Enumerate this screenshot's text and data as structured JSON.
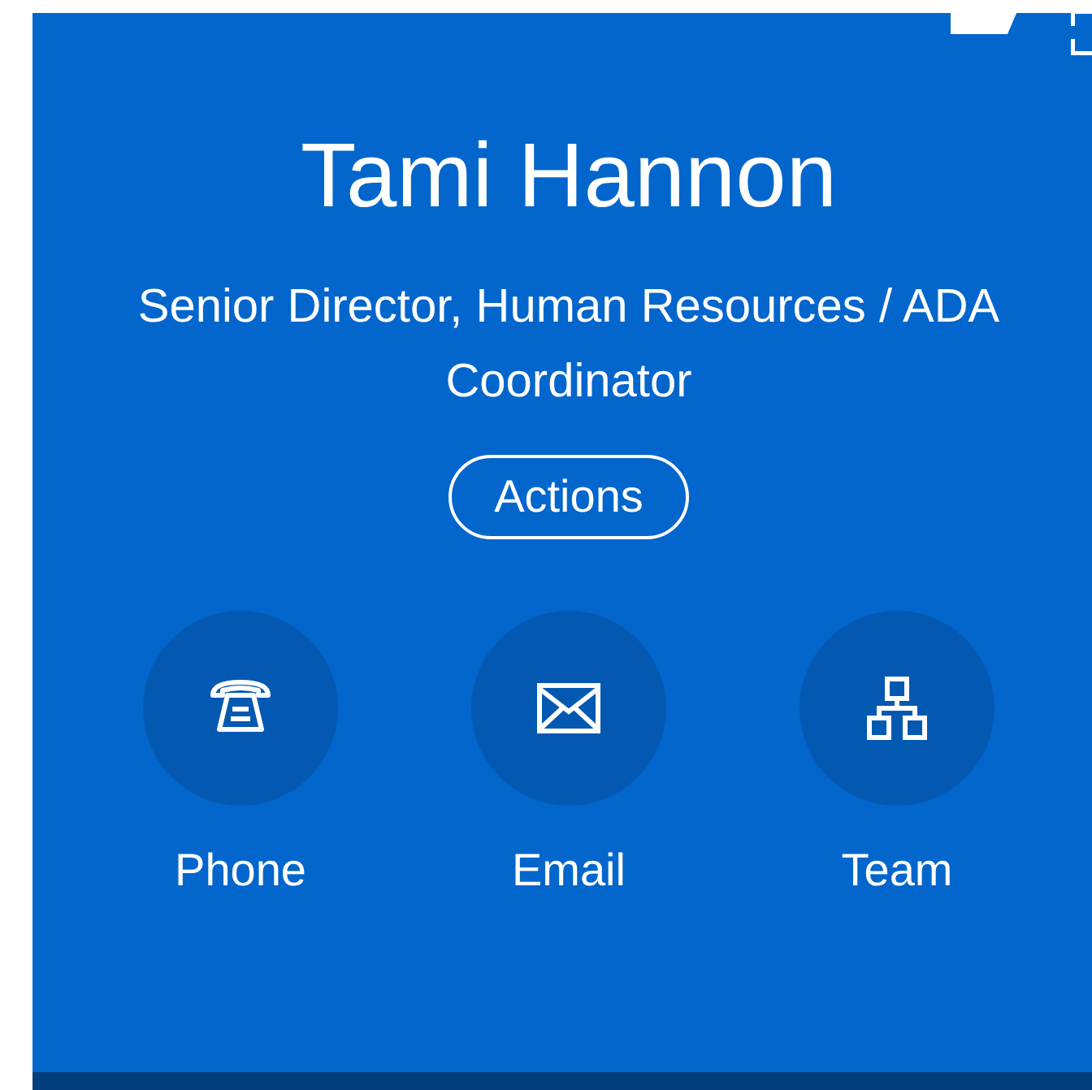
{
  "profile": {
    "name": "Tami Hannon",
    "title": "Senior Director, Human Resources / ADA Coordinator"
  },
  "actions_button": {
    "label": "Actions"
  },
  "quick_actions": [
    {
      "kind": "phone",
      "label": "Phone"
    },
    {
      "kind": "email",
      "label": "Email"
    },
    {
      "kind": "team",
      "label": "Team"
    }
  ]
}
